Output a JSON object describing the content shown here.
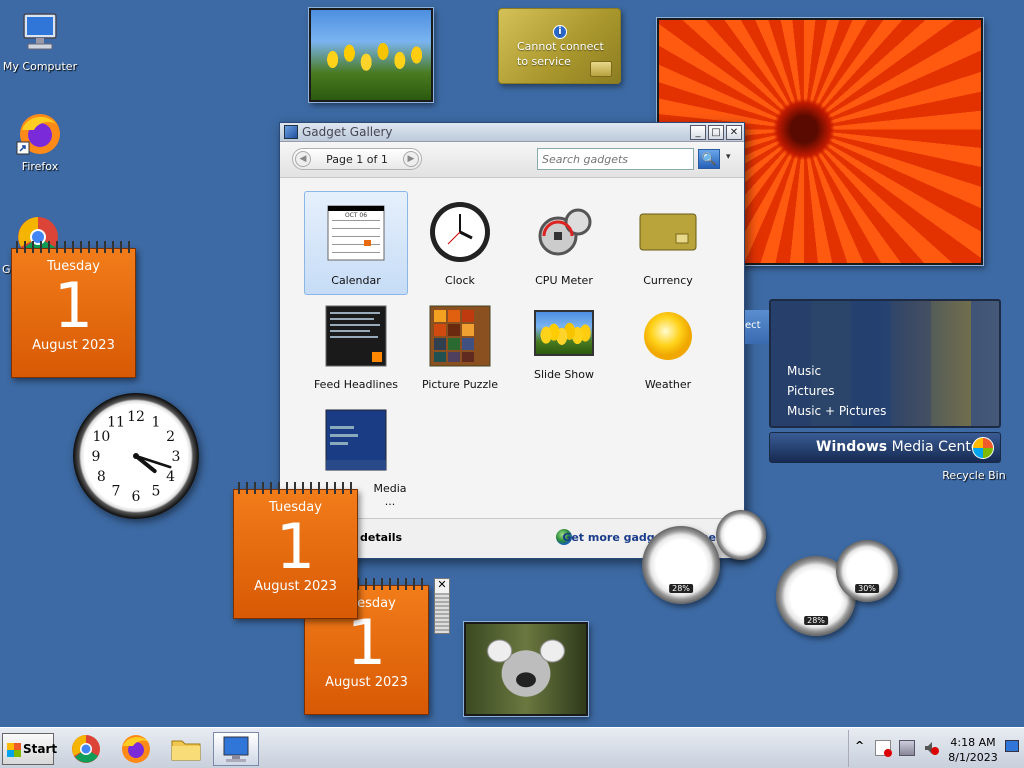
{
  "desktop": {
    "icons": [
      {
        "label": "My Computer"
      },
      {
        "label": "Firefox"
      },
      {
        "label": "Go"
      },
      {
        "label": "Recycle Bin"
      }
    ]
  },
  "currency_gadget": {
    "message_line1": "Cannot connect",
    "message_line2": "to service",
    "info": "i"
  },
  "calendars": [
    {
      "dow": "Tuesday",
      "day": "1",
      "month_year": "August 2023"
    },
    {
      "dow": "Tuesday",
      "day": "1",
      "month_year": "August 2023"
    },
    {
      "dow": "esday",
      "day": "1",
      "month_year": "August 2023"
    }
  ],
  "clock_gadget": {
    "numerals": [
      "12",
      "1",
      "2",
      "3",
      "4",
      "5",
      "6",
      "7",
      "8",
      "9",
      "10",
      "11"
    ],
    "hours": 4,
    "minutes": 18
  },
  "gallery": {
    "title": "Gadget Gallery",
    "page_label": "Page 1 of 1",
    "prev": "◀",
    "next": "▶",
    "search_placeholder": "Search gadgets",
    "search_icon": "🔍",
    "dropdown": "▾",
    "minimize": "_",
    "maximize": "□",
    "close": "✕",
    "gadgets": [
      {
        "name": "Calendar",
        "icon": "calendar-icon"
      },
      {
        "name": "Clock",
        "icon": "clock-icon"
      },
      {
        "name": "CPU Meter",
        "icon": "cpu-meter-icon"
      },
      {
        "name": "Currency",
        "icon": "currency-icon"
      },
      {
        "name": "Feed Headlines",
        "icon": "feed-icon"
      },
      {
        "name": "Picture Puzzle",
        "icon": "puzzle-icon"
      },
      {
        "name": "Slide Show",
        "icon": "slideshow-icon"
      },
      {
        "name": "Weather",
        "icon": "weather-icon"
      },
      {
        "name": "Media ...",
        "icon": "media-center-icon"
      }
    ],
    "cal_thumb_month": "OCT 06",
    "details_label": "details",
    "more_link": "Get more gadgets online"
  },
  "media_center": {
    "items": [
      "Music",
      "Pictures",
      "Music + Pictures"
    ],
    "brand_bold": "Windows",
    "brand_rest": " Media Center",
    "side_text": "ect"
  },
  "cpu_meters": [
    {
      "value": "28%"
    },
    {
      "value": "28%"
    },
    {
      "value": "30%"
    }
  ],
  "handle": {
    "close": "✕"
  },
  "taskbar": {
    "start_label": "Start",
    "tray_expand": "^",
    "time": "4:18 AM",
    "date": "8/1/2023"
  },
  "colors": {
    "desktop": "#3d6aa4",
    "calendar_orange": "#e2680c",
    "link_blue": "#1a3c8a"
  }
}
